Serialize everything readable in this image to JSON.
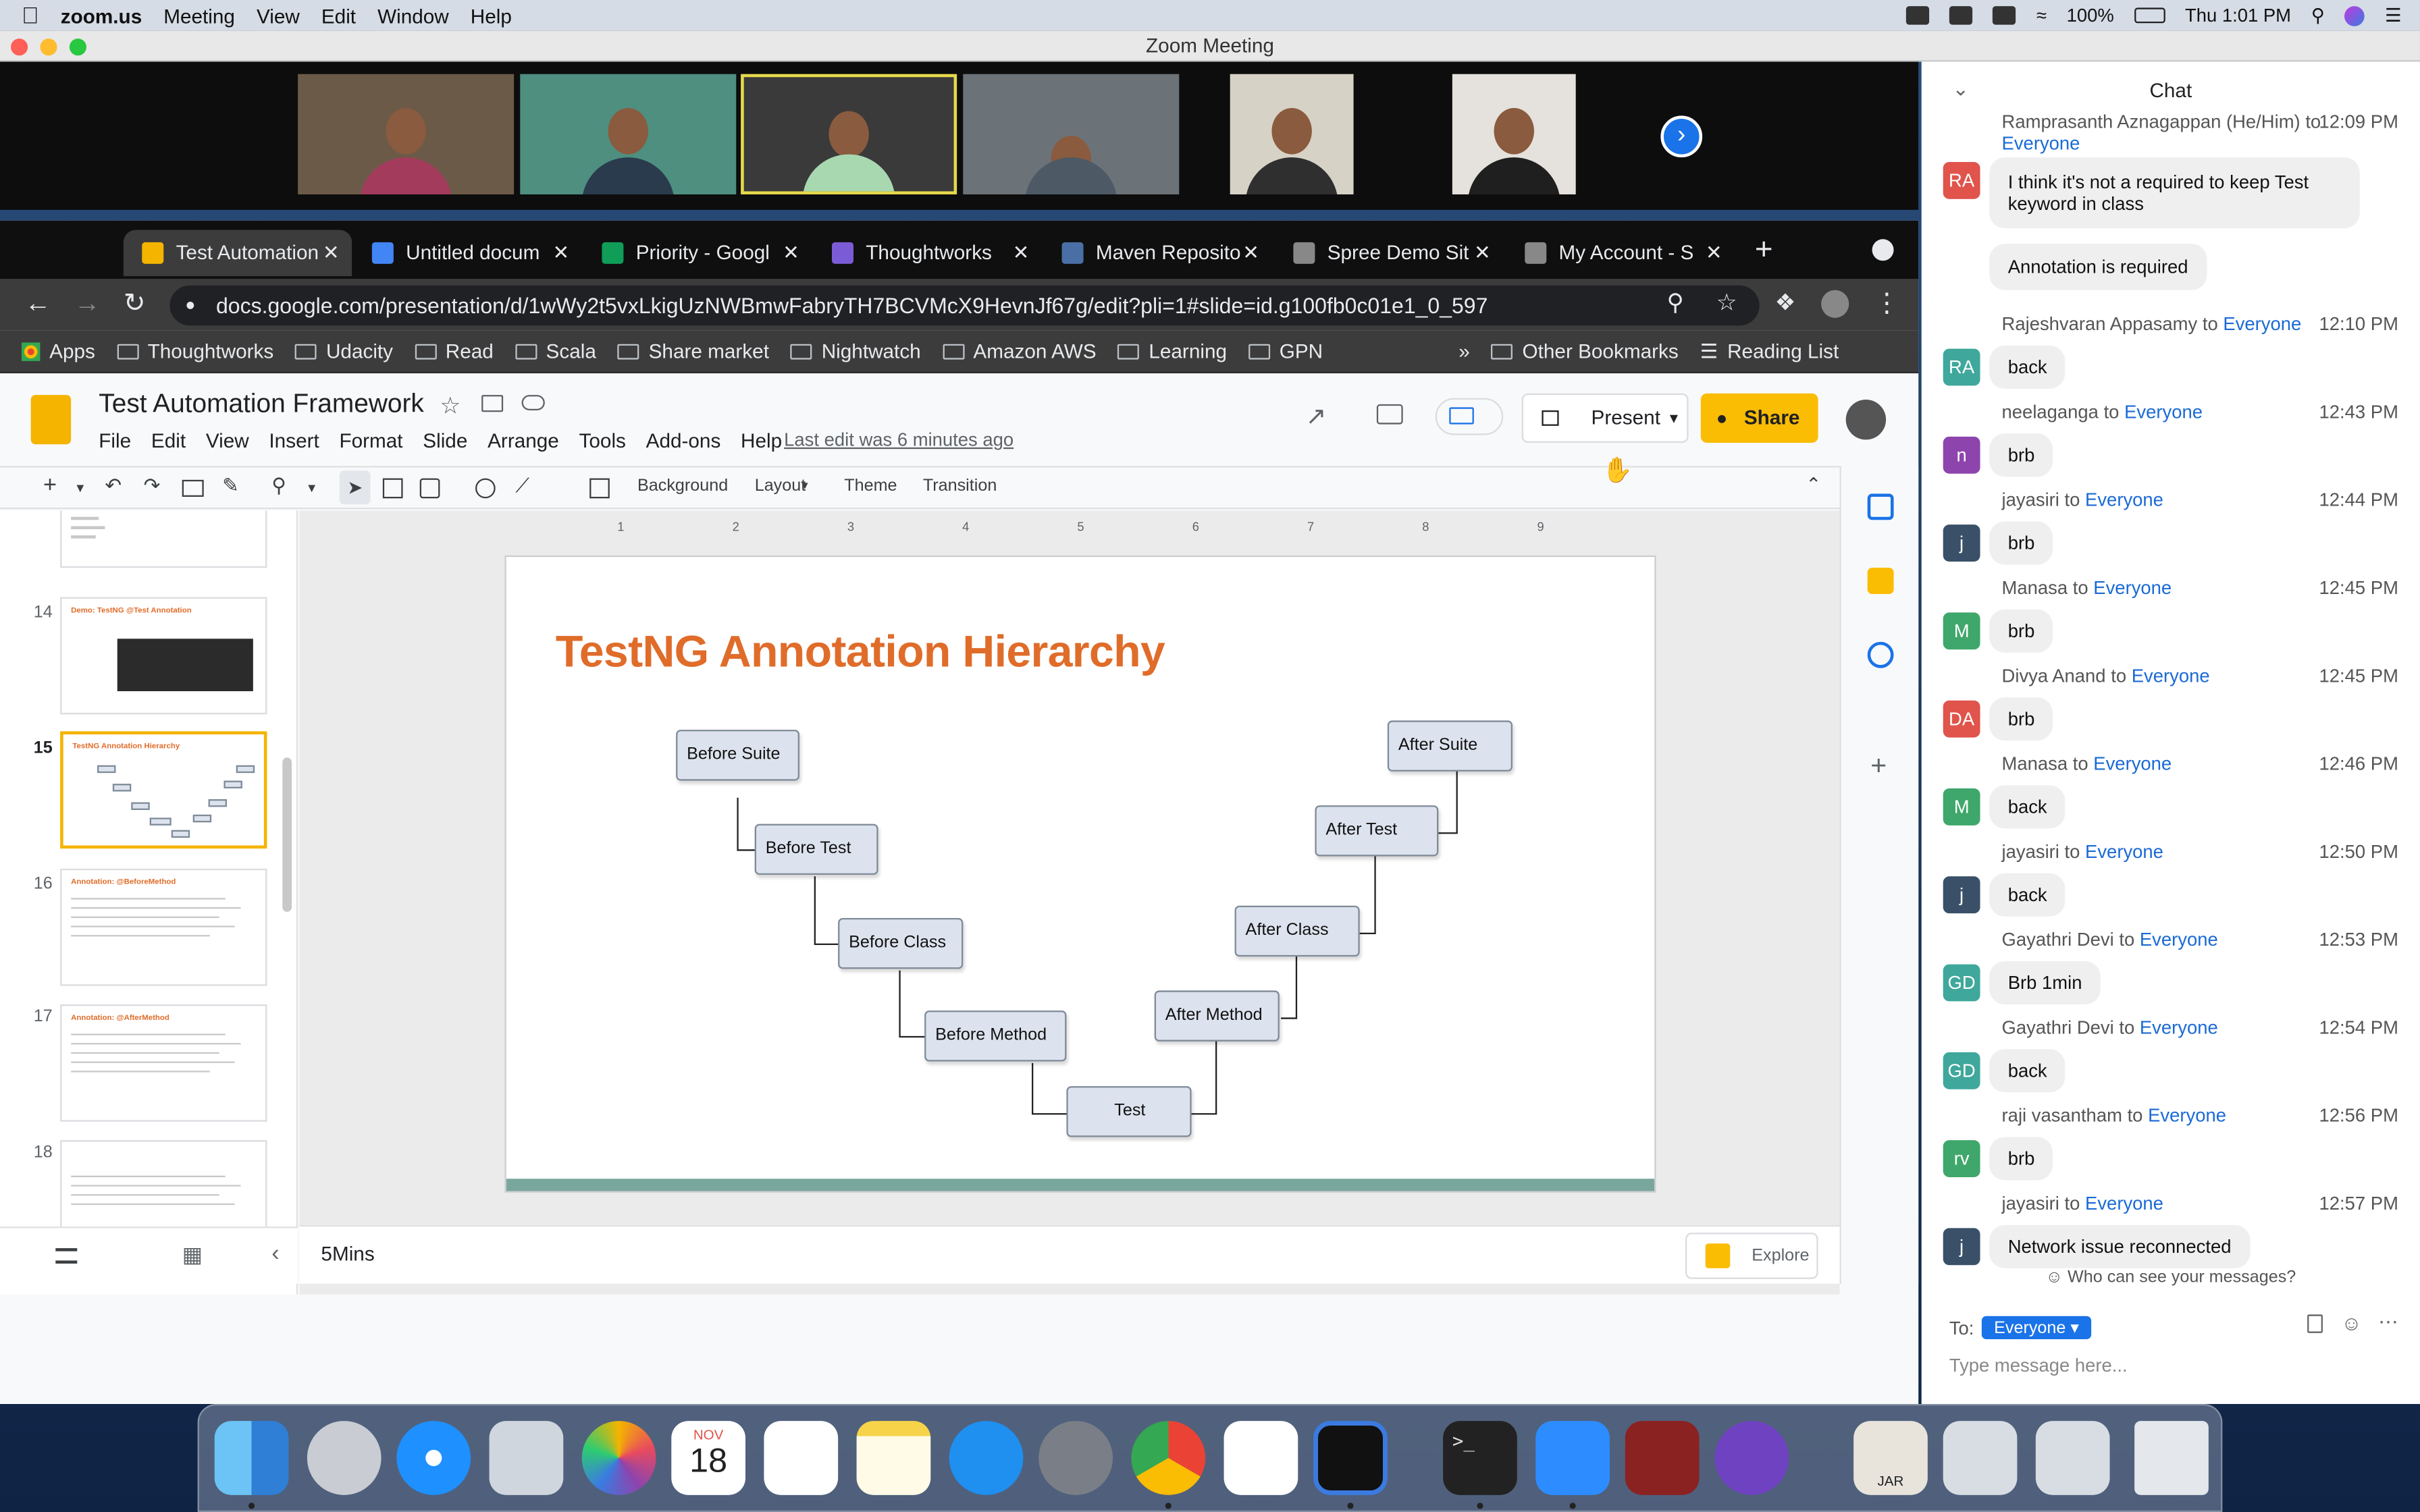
{
  "menubar": {
    "app": "zoom.us",
    "items": [
      "Meeting",
      "View",
      "Edit",
      "Window",
      "Help"
    ],
    "battery": "100%",
    "clock": "Thu 1:01 PM"
  },
  "zoom": {
    "window_title": "Zoom Meeting"
  },
  "browser": {
    "tabs": [
      {
        "label": "Test Automation",
        "active": true,
        "color": "#f4b400"
      },
      {
        "label": "Untitled docum",
        "color": "#4285f4"
      },
      {
        "label": "Priority - Googl",
        "color": "#0f9d58"
      },
      {
        "label": "Thoughtworks",
        "color": "#7b5cd6"
      },
      {
        "label": "Maven Reposito",
        "color": "#4a6fa5"
      },
      {
        "label": "Spree Demo Sit",
        "color": "#888888"
      },
      {
        "label": "My Account - S",
        "color": "#888888"
      }
    ],
    "url": "docs.google.com/presentation/d/1wWy2t5vxLkigUzNWBmwFabryTH7BCVMcX9HevnJf67g/edit?pli=1#slide=id.g100fb0c01e1_0_597",
    "bookmarks": [
      "Apps",
      "Thoughtworks",
      "Udacity",
      "Read",
      "Scala",
      "Share market",
      "Nightwatch",
      "Amazon AWS",
      "Learning",
      "GPN"
    ],
    "bookmarks_more": "»",
    "other_bookmarks": "Other Bookmarks",
    "reading_list": "Reading List"
  },
  "slides": {
    "doc_title": "Test Automation Framework",
    "menus": [
      "File",
      "Edit",
      "View",
      "Insert",
      "Format",
      "Slide",
      "Arrange",
      "Tools",
      "Add-ons",
      "Help"
    ],
    "last_edit": "Last edit was 6 minutes ago",
    "present": "Present",
    "share": "Share",
    "toolbar": {
      "background": "Background",
      "layout": "Layout",
      "theme": "Theme",
      "transition": "Transition"
    },
    "ruler": [
      "1",
      "2",
      "3",
      "4",
      "5",
      "6",
      "7",
      "8",
      "9"
    ],
    "slide_numbers": [
      "14",
      "15",
      "16",
      "17",
      "18"
    ],
    "thumb_titles": [
      "Demo: TestNG @Test Annotation",
      "TestNG Annotation Hierarchy",
      "Annotation: @BeforeMethod",
      "Annotation: @AfterMethod",
      ""
    ],
    "current_slide": {
      "title": "TestNG Annotation Hierarchy",
      "boxes": [
        "Before Suite",
        "Before Test",
        "Before Class",
        "Before Method",
        "Test",
        "After Method",
        "After Class",
        "After Test",
        "After Suite"
      ]
    },
    "notes": "5Mins",
    "explore": "Explore"
  },
  "chat": {
    "title": "Chat",
    "messages": [
      {
        "initials": "RA",
        "color": "#e0544b",
        "sender": "Ramprasanth Aznagappan (He/Him)",
        "to": "Everyone",
        "time": "12:09 PM",
        "bubbles": [
          "I think it's not a required to keep Test keyword in class",
          "Annotation is required"
        ]
      },
      {
        "initials": "RA",
        "color": "#3fa79b",
        "sender": "Rajeshvaran Appasamy",
        "to": "Everyone",
        "time": "12:10 PM",
        "bubbles": [
          "back"
        ]
      },
      {
        "initials": "n",
        "color": "#8e44ad",
        "sender": "neelaganga",
        "to": "Everyone",
        "time": "12:43 PM",
        "bubbles": [
          "brb"
        ]
      },
      {
        "initials": "j",
        "color": "#3a5068",
        "sender": "jayasiri",
        "to": "Everyone",
        "time": "12:44 PM",
        "bubbles": [
          "brb"
        ]
      },
      {
        "initials": "M",
        "color": "#3fa76b",
        "sender": "Manasa",
        "to": "Everyone",
        "time": "12:45 PM",
        "bubbles": [
          "brb"
        ]
      },
      {
        "initials": "DA",
        "color": "#e0544b",
        "sender": "Divya Anand",
        "to": "Everyone",
        "time": "12:45 PM",
        "bubbles": [
          "brb"
        ]
      },
      {
        "initials": "M",
        "color": "#3fa76b",
        "sender": "Manasa",
        "to": "Everyone",
        "time": "12:46 PM",
        "bubbles": [
          "back"
        ]
      },
      {
        "initials": "j",
        "color": "#3a5068",
        "sender": "jayasiri",
        "to": "Everyone",
        "time": "12:50 PM",
        "bubbles": [
          "back"
        ]
      },
      {
        "initials": "GD",
        "color": "#3fa79b",
        "sender": "Gayathri Devi",
        "to": "Everyone",
        "time": "12:53 PM",
        "bubbles": [
          "Brb 1min"
        ]
      },
      {
        "initials": "GD",
        "color": "#3fa79b",
        "sender": "Gayathri Devi",
        "to": "Everyone",
        "time": "12:54 PM",
        "bubbles": [
          "back"
        ]
      },
      {
        "initials": "rv",
        "color": "#3fa76b",
        "sender": "raji vasantham",
        "to": "Everyone",
        "time": "12:56 PM",
        "bubbles": [
          "brb"
        ]
      },
      {
        "initials": "j",
        "color": "#3a5068",
        "sender": "jayasiri",
        "to": "Everyone",
        "time": "12:57 PM",
        "bubbles": [
          "Network issue reconnected"
        ]
      }
    ],
    "who_can_see": "Who can see your messages?",
    "to_label": "To:",
    "to_value": "Everyone",
    "input_placeholder": "Type message here..."
  },
  "dock": {
    "calendar_month": "NOV",
    "calendar_day": "18",
    "jar_label": "JAR"
  }
}
